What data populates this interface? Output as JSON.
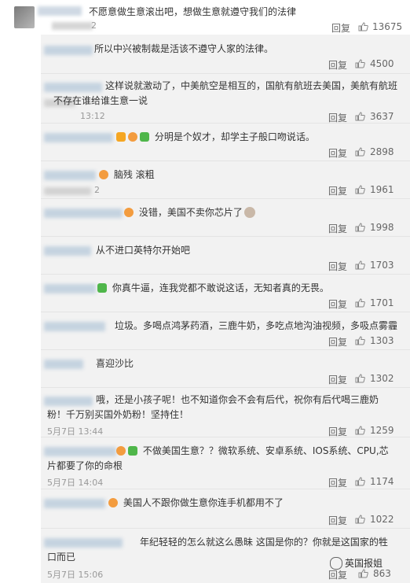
{
  "top_comment": {
    "text": "不愿意做生意滚出吧，想做生意就遵守我们的法律",
    "time": "2",
    "reply": "回复",
    "likes": "13675"
  },
  "replies": [
    {
      "text": "所以中兴被制裁是活该不遵守人家的法律。",
      "time": "",
      "reply": "回复",
      "likes": "4500"
    },
    {
      "text_1": "这样说就激动了，中美航空是相互的，国航有航班去美国，美航有航班",
      "text_2": "不存在谁给谁生意一说",
      "time": "13:12",
      "reply": "回复",
      "likes": "3637"
    },
    {
      "text": "分明是个奴才，却学主子般口吻说话。",
      "time": "",
      "reply": "回复",
      "likes": "2898"
    },
    {
      "text": "脑残 滚粗",
      "time": "2",
      "reply": "回复",
      "likes": "1961"
    },
    {
      "text": "没错，美国不卖你芯片了",
      "time": "",
      "reply": "回复",
      "likes": "1998"
    },
    {
      "text": "从不进口英特尔开始吧",
      "time": "",
      "reply": "回复",
      "likes": "1703"
    },
    {
      "text": "你真牛逼，连我党都不敢说这话，无知者真的无畏。",
      "time": "",
      "reply": "回复",
      "likes": "1701"
    },
    {
      "text": "垃圾。多喝点鸿茅药酒，三鹿牛奶，多吃点地沟油视频，多吸点雾霾",
      "time": "",
      "reply": "回复",
      "likes": "1303"
    },
    {
      "text": "喜迎沙比",
      "time": "",
      "reply": "回复",
      "likes": "1302"
    },
    {
      "text_1": "哦，还是小孩子呢！也不知道你会不会有后代，祝你有后代喝三鹿奶",
      "text_2": "粉！千万别买国外奶粉！坚持住！",
      "time": "5月7日 13:44",
      "reply": "回复",
      "likes": "1259"
    },
    {
      "text_1": "不做美国生意？？微软系统、安卓系统、IOS系统、CPU,芯",
      "text_2": "片都要了你的命根",
      "time": "5月7日 14:04",
      "reply": "回复",
      "likes": "1174"
    },
    {
      "text": "美国人不跟你做生意你连手机都用不了",
      "time": "",
      "reply": "回复",
      "likes": "1022"
    },
    {
      "text_1": "年纪轻轻的怎么就这么愚昧 这国是你的？你就是这国家的牲",
      "text_2": "口而已",
      "time": "5月7日 15:06",
      "reply": "回复",
      "likes": "863"
    }
  ],
  "watermark": "英国报姐",
  "colors": {
    "background": "#f2f2f2",
    "text": "#333333",
    "meta": "#999999"
  }
}
